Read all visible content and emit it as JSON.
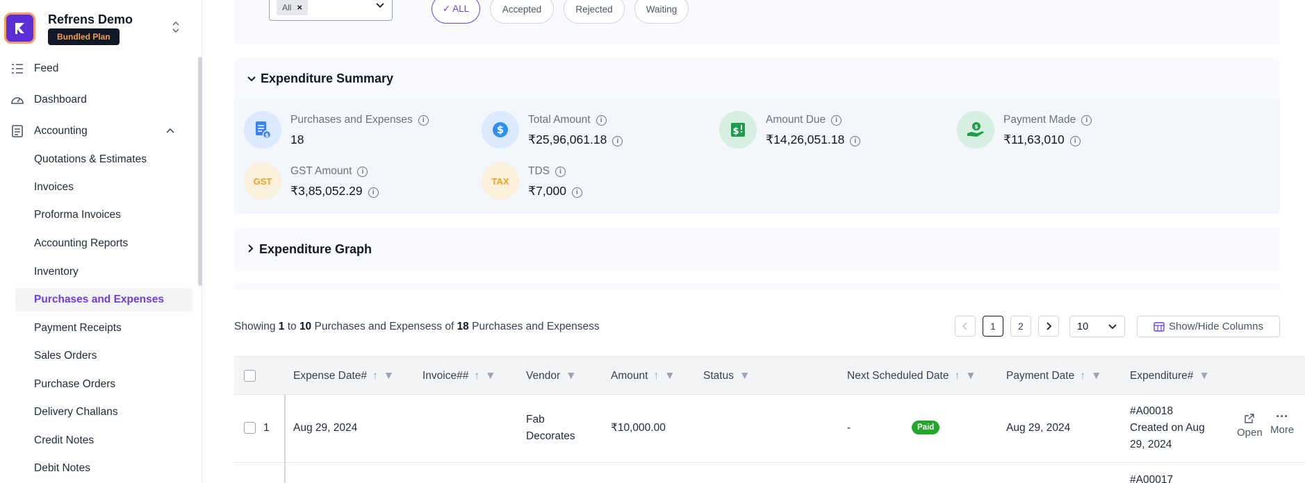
{
  "org": {
    "name": "Refrens Demo",
    "plan": "Bundled Plan"
  },
  "sidebar": {
    "top_items": [
      {
        "label": "Feed",
        "icon": "feed-icon"
      },
      {
        "label": "Dashboard",
        "icon": "dashboard-icon"
      },
      {
        "label": "Accounting",
        "icon": "accounting-icon"
      }
    ],
    "sub_items": [
      "Quotations & Estimates",
      "Invoices",
      "Proforma Invoices",
      "Accounting Reports",
      "Inventory",
      "Purchases and Expenses",
      "Payment Receipts",
      "Sales Orders",
      "Purchase Orders",
      "Delivery Challans",
      "Credit Notes",
      "Debit Notes"
    ],
    "active_item": "Purchases and Expenses"
  },
  "filters": {
    "tag_chip": "All",
    "status_pills": [
      "✓ ALL",
      "Accepted",
      "Rejected",
      "Waiting"
    ],
    "active_pill": "✓ ALL"
  },
  "summary": {
    "title": "Expenditure Summary",
    "stats": [
      {
        "label": "Purchases and Expenses",
        "value": "18",
        "icon": "document-money-icon"
      },
      {
        "label": "Total Amount",
        "value": "₹25,96,061.18",
        "icon": "dollar-coin-icon"
      },
      {
        "label": "Amount Due",
        "value": "₹14,26,051.18",
        "icon": "money-alert-icon"
      },
      {
        "label": "Payment Made",
        "value": "₹11,63,010",
        "icon": "hand-coin-icon"
      },
      {
        "label": "GST Amount",
        "value": "₹3,85,052.29",
        "icon": "gst-icon",
        "icon_text": "GST"
      },
      {
        "label": "TDS",
        "value": "₹7,000",
        "icon": "tax-icon",
        "icon_text": "TAX"
      }
    ]
  },
  "graph": {
    "title": "Expenditure Graph"
  },
  "pagination": {
    "showing_prefix": "Showing ",
    "from": "1",
    "to_word": " to ",
    "to": "10",
    "middle": " Purchases and Expensess of ",
    "total": "18",
    "suffix": " Purchases and Expensess",
    "pages": [
      "1",
      "2"
    ],
    "current_page": "1",
    "per_page": "10",
    "show_hide_label": "Show/Hide Columns"
  },
  "table": {
    "columns": [
      "Expense Date#",
      "Invoice##",
      "Vendor",
      "Amount",
      "Status",
      "Next Scheduled Date",
      "Payment Date",
      "Expenditure#"
    ],
    "rows": [
      {
        "index": "1",
        "expense_date": "Aug 29, 2024",
        "invoice": "",
        "vendor": "Fab Decorates",
        "amount": "₹10,000.00",
        "status": "Paid",
        "next_scheduled": "-",
        "payment_date": "Aug 29, 2024",
        "expenditure_no": "#A00018",
        "created_on": "Created on Aug 29, 2024",
        "open_label": "Open",
        "more_label": "More"
      },
      {
        "expenditure_no": "#A00017"
      }
    ]
  },
  "colors": {
    "accent": "#6d3ee6",
    "paid": "#22a529",
    "logo_bg": "#5b2fd6"
  }
}
